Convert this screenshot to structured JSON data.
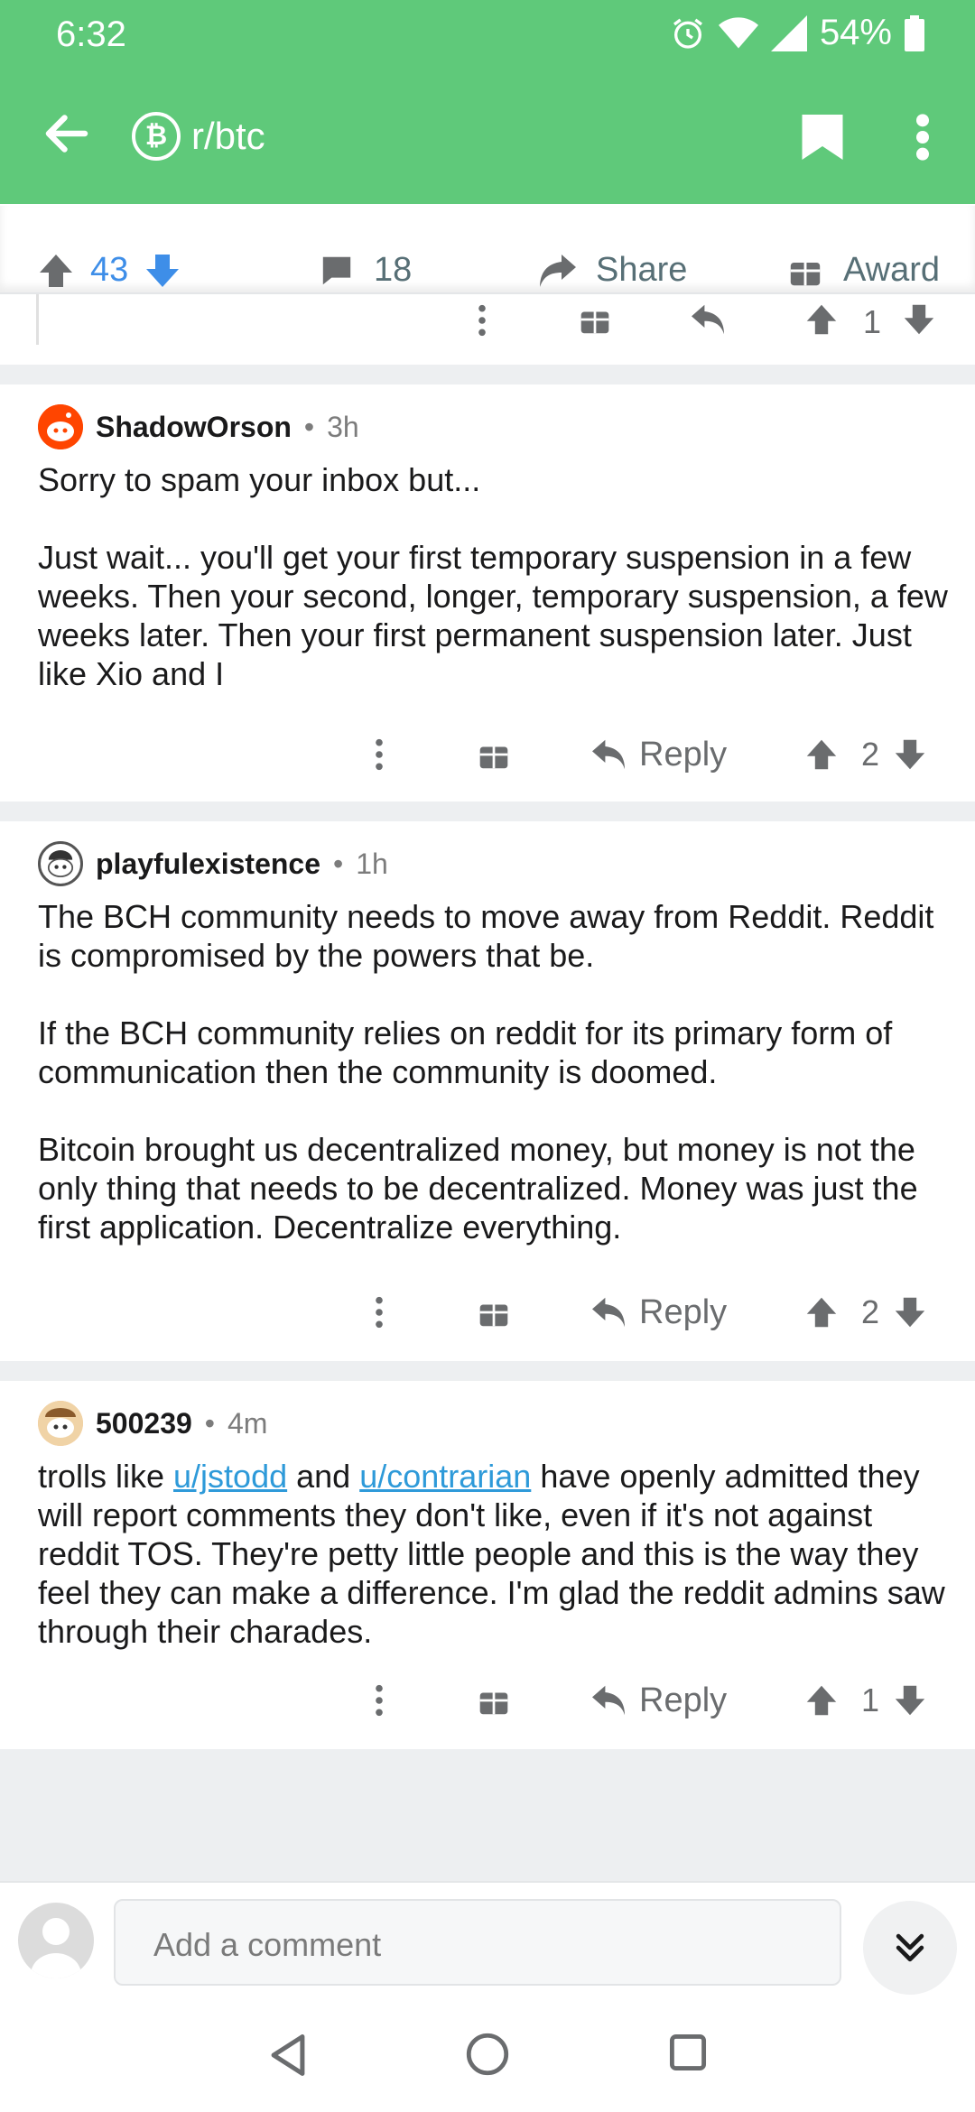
{
  "status_bar": {
    "time": "6:32",
    "battery": "54%"
  },
  "app_bar": {
    "subreddit": "r/btc",
    "sub_icon_glyph": "₿"
  },
  "post_actions": {
    "votes": "43",
    "comments": "18",
    "share": "Share",
    "award": "Award"
  },
  "prev_comment": {
    "score": "1"
  },
  "comments": [
    {
      "author": "ShadowOrson",
      "time": "3h",
      "paragraphs": [
        "Sorry to spam your inbox but...",
        "Just wait... you'll get your first temporary suspension in a few weeks. Then your second, longer, temporary suspension, a few weeks later. Then your first permanent suspension later. Just like Xio and I"
      ],
      "reply": "Reply",
      "score": "2"
    },
    {
      "author": "playfulexistence",
      "time": "1h",
      "paragraphs": [
        "The BCH community needs to move away from Reddit. Reddit is compromised by the powers that be.",
        "If the BCH community relies on reddit for its primary form of communication then the community is doomed.",
        "Bitcoin brought us decentralized money, but money is not the only thing that needs to be decentralized. Money was just the first application. Decentralize everything."
      ],
      "reply": "Reply",
      "score": "2"
    },
    {
      "author": "500239",
      "time": "4m",
      "text_parts": {
        "a": "trolls like ",
        "link1": "u/jstodd",
        "b": " and ",
        "link2": "u/contrarian",
        "c": " have openly admitted they will report comments they don't like, even if it's not against reddit TOS. They're petty little people and this is the way they feel they can make a difference. I'm glad the reddit admins saw through their charades."
      },
      "reply": "Reply",
      "score": "1"
    }
  ],
  "composer": {
    "placeholder": "Add a comment"
  },
  "colors": {
    "brand": "#5fc97a",
    "upvote": "#3e8ee8",
    "link": "#2e9ad9"
  },
  "icons": [
    "back-arrow-icon",
    "bitcoin-icon",
    "bookmark-icon",
    "more-vert-icon",
    "upvote-icon",
    "downvote-icon",
    "comment-icon",
    "share-icon",
    "gift-icon",
    "reply-icon",
    "chevron-double-down-icon"
  ]
}
